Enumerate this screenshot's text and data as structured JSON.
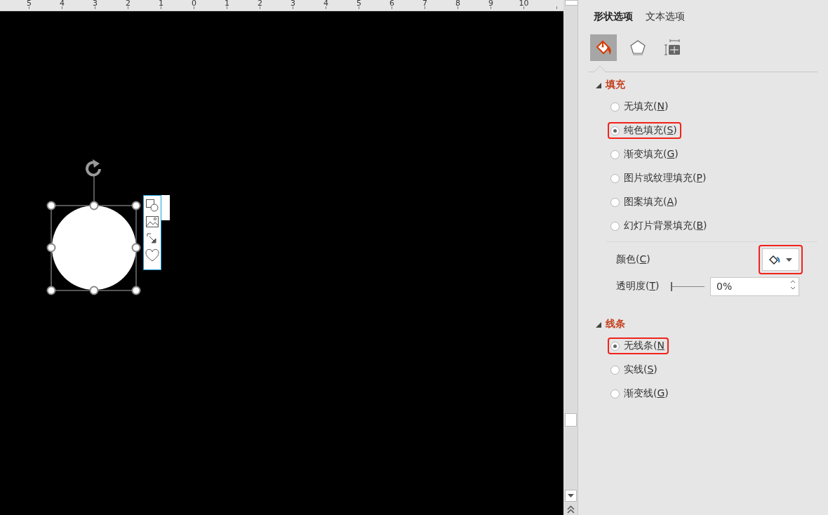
{
  "ruler": {
    "labels": [
      "5",
      "4",
      "3",
      "2",
      "1",
      "0",
      "1",
      "2",
      "3",
      "4",
      "5",
      "6",
      "7",
      "8",
      "9",
      "10"
    ]
  },
  "slide": {
    "shape": {
      "kind": "circle",
      "selected": true
    }
  },
  "pane": {
    "tabs": [
      {
        "label": "形状选项",
        "selected": true
      },
      {
        "label": "文本选项",
        "selected": false
      }
    ],
    "categories": [
      {
        "kind": "fill-line",
        "selected": true
      },
      {
        "kind": "effects",
        "selected": false
      },
      {
        "kind": "size",
        "selected": false
      }
    ],
    "sections": [
      {
        "title": "填充",
        "expanded": true,
        "options": [
          {
            "label": "无填充(N)",
            "selected": false,
            "highlighted": false
          },
          {
            "label": "纯色填充(S)",
            "selected": true,
            "highlighted": true
          },
          {
            "label": "渐变填充(G)",
            "selected": false,
            "highlighted": false
          },
          {
            "label": "图片或纹理填充(P)",
            "selected": false,
            "highlighted": false
          },
          {
            "label": "图案填充(A)",
            "selected": false,
            "highlighted": false
          },
          {
            "label": "幻灯片背景填充(B)",
            "selected": false,
            "highlighted": false
          }
        ],
        "color": {
          "label": "颜色(C)",
          "highlighted": true
        },
        "transparency": {
          "label": "透明度(T)",
          "value": "0%",
          "level": 0
        }
      },
      {
        "title": "线条",
        "expanded": true,
        "options": [
          {
            "label": "无线条(N",
            "selected": true,
            "highlighted": true
          },
          {
            "label": "实线(S)",
            "selected": false,
            "highlighted": false
          },
          {
            "label": "渐变线(G)",
            "selected": false,
            "highlighted": false
          }
        ]
      }
    ]
  }
}
